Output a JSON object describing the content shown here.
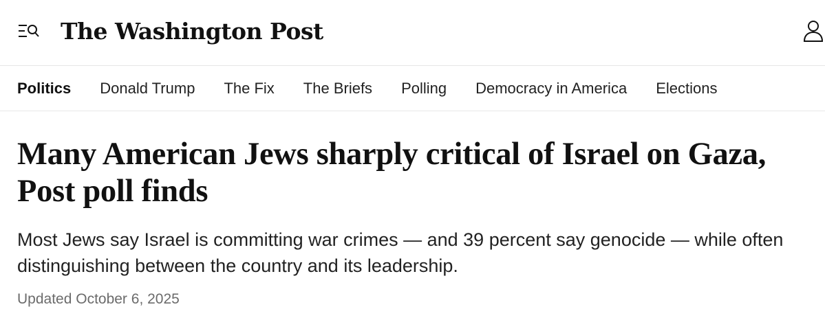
{
  "header": {
    "logo_text": "The Washington Post",
    "menu_icon": "menu-search-icon",
    "account_icon": "user-icon"
  },
  "nav": {
    "items": [
      {
        "label": "Politics",
        "active": true
      },
      {
        "label": "Donald Trump",
        "active": false
      },
      {
        "label": "The Fix",
        "active": false
      },
      {
        "label": "The Briefs",
        "active": false
      },
      {
        "label": "Polling",
        "active": false
      },
      {
        "label": "Democracy in America",
        "active": false
      },
      {
        "label": "Elections",
        "active": false
      }
    ]
  },
  "article": {
    "headline": "Many American Jews sharply critical of Israel on Gaza, Post poll finds",
    "subheadline": "Most Jews say Israel is committing war crimes — and 39 percent say genocide — while often distinguishing between the country and its leadership.",
    "timestamp": "Updated October 6, 2025"
  },
  "colors": {
    "text": "#111111",
    "muted": "#6b6b6b",
    "divider": "#e5e5e5"
  }
}
